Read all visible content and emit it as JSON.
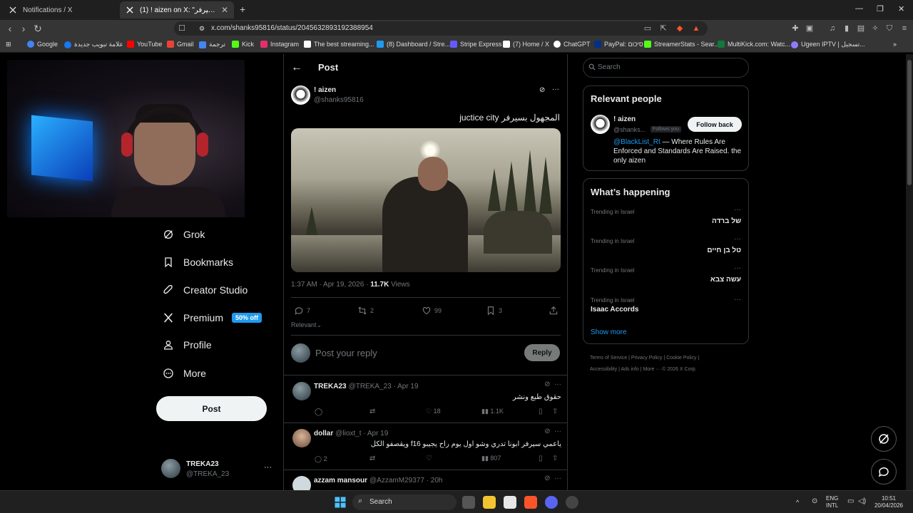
{
  "browser": {
    "tabs": [
      {
        "title": "Notifications / X"
      },
      {
        "title": "(1) ! aizen on X: \"المجهول بسيرفر"
      }
    ],
    "url": "x.com/shanks95816/status/2045632893192388954",
    "bookmarks": [
      {
        "label": "Google",
        "color": "#4285f4"
      },
      {
        "label": "علامة تبويب جديدة",
        "color": "#1877f2"
      },
      {
        "label": "YouTube",
        "color": "#ff0000"
      },
      {
        "label": "Gmail",
        "color": "#ea4335"
      },
      {
        "label": "ترجمة",
        "color": "#4285f4"
      },
      {
        "label": "Kick",
        "color": "#53fc18"
      },
      {
        "label": "Instagram",
        "color": "#e1306c"
      },
      {
        "label": "The best streaming...",
        "color": "#ffffff"
      },
      {
        "label": "(8) Dashboard / Stre...",
        "color": "#1d9bf0"
      },
      {
        "label": "Stripe Express",
        "color": "#635bff"
      },
      {
        "label": "(7) Home / X",
        "color": "#ffffff"
      },
      {
        "label": "ChatGPT",
        "color": "#ffffff"
      },
      {
        "label": "PayPal: סיכום",
        "color": "#003087"
      },
      {
        "label": "StreamerStats - Sear...",
        "color": "#53fc18"
      },
      {
        "label": "MultiKick.com: Watc...",
        "color": "#0f7a3a"
      },
      {
        "label": "Ugeen IPTV | تسجيل...",
        "color": "#8e7cff"
      }
    ]
  },
  "nav": {
    "items": [
      {
        "label": "Grok"
      },
      {
        "label": "Bookmarks"
      },
      {
        "label": "Creator Studio"
      },
      {
        "label": "Premium",
        "badge": "50% off"
      },
      {
        "label": "Profile"
      },
      {
        "label": "More"
      }
    ],
    "post_button": "Post",
    "account": {
      "name": "TREKA23",
      "handle": "@TREKA_23",
      "more": "···"
    }
  },
  "post": {
    "header": "Post",
    "author": {
      "name": "! aizen",
      "handle": "@shanks95816"
    },
    "text": "المجهول بسيرفر juctice city",
    "time": "1:37 AM · Apr 19, 2026 · ",
    "views_count": "11.7K",
    "views_label": " Views",
    "stats": {
      "replies": "7",
      "reposts": "2",
      "likes": "99",
      "bookmarks": "3"
    },
    "sort_label": "Relevant",
    "reply_placeholder": "Post your reply",
    "reply_button": "Reply"
  },
  "replies": [
    {
      "name": "TREKA23",
      "handle": "@TREKA_23 · Apr 19",
      "text": "حقوق طبع ونشر",
      "replies": "",
      "reposts": "",
      "likes": "18",
      "views": "1.1K"
    },
    {
      "name": "dollar",
      "handle": "@lioxt_t · Apr 19",
      "text": "ياعمي سيرفر ابونا تدري وشو اول يوم راح يجيبو f16 ويقصفو الكل",
      "replies": "2",
      "reposts": "",
      "likes": "",
      "views": "807"
    },
    {
      "name": "azzam mansour",
      "handle": "@AzzamM29377 · 20h",
      "text": "",
      "replies": "",
      "reposts": "",
      "likes": "",
      "views": ""
    }
  ],
  "sidebar": {
    "search_placeholder": "Search",
    "relevant_people": {
      "title": "Relevant people",
      "name": "! aizen",
      "handle": "@shanks...",
      "follows_you": "Follows you",
      "follow_button": "Follow back",
      "bio_link": "@BlackList_Rt",
      "bio_text": " — Where Rules Are Enforced and Standards Are Raised. the only aizen"
    },
    "happening": {
      "title": "What’s happening",
      "trends": [
        {
          "context": "Trending in Israel",
          "name": "של ברדה"
        },
        {
          "context": "Trending in Israel",
          "name": "טל בן חיים"
        },
        {
          "context": "Trending in Israel",
          "name": "עשה צבא"
        },
        {
          "context": "Trending in Israel",
          "name": "Isaac Accords"
        }
      ],
      "show_more": "Show more"
    },
    "footer_line1": "Terms of Service  |  Privacy Policy  |  Cookie Policy  |",
    "footer_line2": "Accessibility  |  Ads info  |  More ···  © 2026 X Corp."
  },
  "taskbar": {
    "search": "Search",
    "lang1": "ENG",
    "lang2": "INTL",
    "time": "10:51",
    "date": "20/04/2026"
  }
}
